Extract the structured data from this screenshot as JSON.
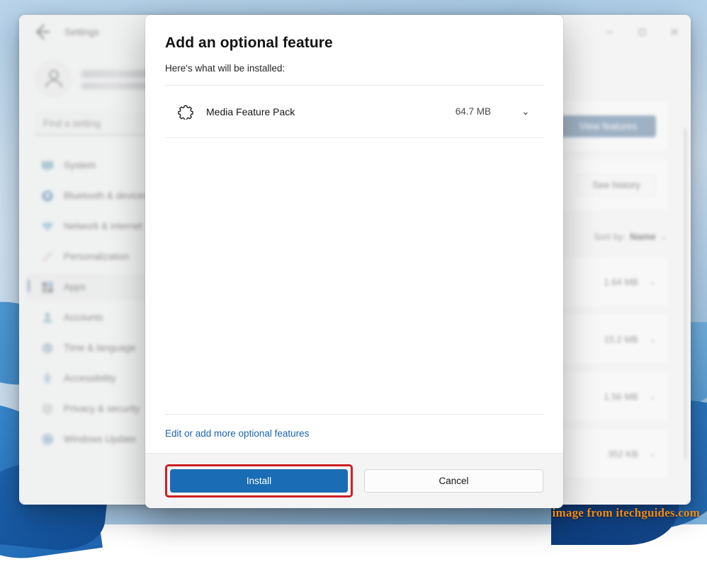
{
  "window": {
    "title": "Settings",
    "back_icon": "back-arrow-icon",
    "controls": {
      "minimize": "minimize-icon",
      "maximize": "maximize-icon",
      "close": "close-icon"
    }
  },
  "sidebar": {
    "account": {
      "avatar_icon": "user-avatar-icon",
      "name_redacted": "",
      "email_redacted": ""
    },
    "search": {
      "placeholder": "Find a setting",
      "value": ""
    },
    "items": [
      {
        "label": "System",
        "icon": "system-icon",
        "selected": false
      },
      {
        "label": "Bluetooth & devices",
        "icon": "bluetooth-icon",
        "selected": false
      },
      {
        "label": "Network & internet",
        "icon": "network-icon",
        "selected": false
      },
      {
        "label": "Personalization",
        "icon": "personalization-icon",
        "selected": false
      },
      {
        "label": "Apps",
        "icon": "apps-icon",
        "selected": true
      },
      {
        "label": "Accounts",
        "icon": "accounts-icon",
        "selected": false
      },
      {
        "label": "Time & language",
        "icon": "time-language-icon",
        "selected": false
      },
      {
        "label": "Accessibility",
        "icon": "accessibility-icon",
        "selected": false
      },
      {
        "label": "Privacy & security",
        "icon": "privacy-security-icon",
        "selected": false
      },
      {
        "label": "Windows Update",
        "icon": "windows-update-icon",
        "selected": false
      }
    ]
  },
  "main": {
    "view_features_label": "View features",
    "see_history_label": "See history",
    "sort": {
      "label": "Sort by:",
      "value": "Name",
      "chevron": "chevron-down-icon"
    },
    "feature_rows": [
      {
        "size": "1.64 MB",
        "chevron": "chevron-down-icon"
      },
      {
        "size": "15.2 MB",
        "chevron": "chevron-down-icon"
      },
      {
        "size": "1.56 MB",
        "chevron": "chevron-down-icon"
      },
      {
        "size": "352 KB",
        "chevron": "chevron-down-icon"
      }
    ]
  },
  "dialog": {
    "title": "Add an optional feature",
    "subtitle": "Here's what will be installed:",
    "items": [
      {
        "name": "Media Feature Pack",
        "size": "64.7 MB",
        "icon": "gear-outline-icon",
        "chevron": "chevron-down-icon"
      }
    ],
    "edit_link": "Edit or add more optional features",
    "install_label": "Install",
    "cancel_label": "Cancel",
    "accent_color": "#1a6cb5",
    "highlight_color": "#cc2026"
  },
  "watermark": {
    "text": "image from itechguides.com",
    "color": "#f08a13"
  }
}
